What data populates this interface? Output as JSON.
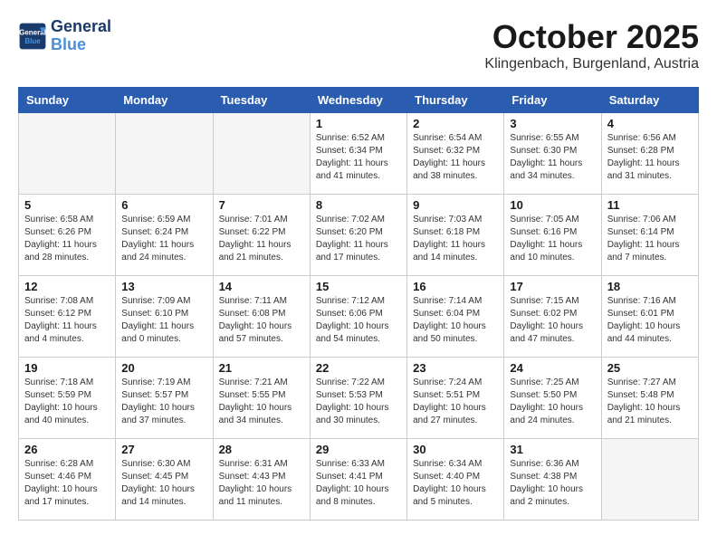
{
  "header": {
    "logo_line1": "General",
    "logo_line2": "Blue",
    "month": "October 2025",
    "location": "Klingenbach, Burgenland, Austria"
  },
  "days_of_week": [
    "Sunday",
    "Monday",
    "Tuesday",
    "Wednesday",
    "Thursday",
    "Friday",
    "Saturday"
  ],
  "weeks": [
    [
      {
        "day": "",
        "info": ""
      },
      {
        "day": "",
        "info": ""
      },
      {
        "day": "",
        "info": ""
      },
      {
        "day": "1",
        "info": "Sunrise: 6:52 AM\nSunset: 6:34 PM\nDaylight: 11 hours\nand 41 minutes."
      },
      {
        "day": "2",
        "info": "Sunrise: 6:54 AM\nSunset: 6:32 PM\nDaylight: 11 hours\nand 38 minutes."
      },
      {
        "day": "3",
        "info": "Sunrise: 6:55 AM\nSunset: 6:30 PM\nDaylight: 11 hours\nand 34 minutes."
      },
      {
        "day": "4",
        "info": "Sunrise: 6:56 AM\nSunset: 6:28 PM\nDaylight: 11 hours\nand 31 minutes."
      }
    ],
    [
      {
        "day": "5",
        "info": "Sunrise: 6:58 AM\nSunset: 6:26 PM\nDaylight: 11 hours\nand 28 minutes."
      },
      {
        "day": "6",
        "info": "Sunrise: 6:59 AM\nSunset: 6:24 PM\nDaylight: 11 hours\nand 24 minutes."
      },
      {
        "day": "7",
        "info": "Sunrise: 7:01 AM\nSunset: 6:22 PM\nDaylight: 11 hours\nand 21 minutes."
      },
      {
        "day": "8",
        "info": "Sunrise: 7:02 AM\nSunset: 6:20 PM\nDaylight: 11 hours\nand 17 minutes."
      },
      {
        "day": "9",
        "info": "Sunrise: 7:03 AM\nSunset: 6:18 PM\nDaylight: 11 hours\nand 14 minutes."
      },
      {
        "day": "10",
        "info": "Sunrise: 7:05 AM\nSunset: 6:16 PM\nDaylight: 11 hours\nand 10 minutes."
      },
      {
        "day": "11",
        "info": "Sunrise: 7:06 AM\nSunset: 6:14 PM\nDaylight: 11 hours\nand 7 minutes."
      }
    ],
    [
      {
        "day": "12",
        "info": "Sunrise: 7:08 AM\nSunset: 6:12 PM\nDaylight: 11 hours\nand 4 minutes."
      },
      {
        "day": "13",
        "info": "Sunrise: 7:09 AM\nSunset: 6:10 PM\nDaylight: 11 hours\nand 0 minutes."
      },
      {
        "day": "14",
        "info": "Sunrise: 7:11 AM\nSunset: 6:08 PM\nDaylight: 10 hours\nand 57 minutes."
      },
      {
        "day": "15",
        "info": "Sunrise: 7:12 AM\nSunset: 6:06 PM\nDaylight: 10 hours\nand 54 minutes."
      },
      {
        "day": "16",
        "info": "Sunrise: 7:14 AM\nSunset: 6:04 PM\nDaylight: 10 hours\nand 50 minutes."
      },
      {
        "day": "17",
        "info": "Sunrise: 7:15 AM\nSunset: 6:02 PM\nDaylight: 10 hours\nand 47 minutes."
      },
      {
        "day": "18",
        "info": "Sunrise: 7:16 AM\nSunset: 6:01 PM\nDaylight: 10 hours\nand 44 minutes."
      }
    ],
    [
      {
        "day": "19",
        "info": "Sunrise: 7:18 AM\nSunset: 5:59 PM\nDaylight: 10 hours\nand 40 minutes."
      },
      {
        "day": "20",
        "info": "Sunrise: 7:19 AM\nSunset: 5:57 PM\nDaylight: 10 hours\nand 37 minutes."
      },
      {
        "day": "21",
        "info": "Sunrise: 7:21 AM\nSunset: 5:55 PM\nDaylight: 10 hours\nand 34 minutes."
      },
      {
        "day": "22",
        "info": "Sunrise: 7:22 AM\nSunset: 5:53 PM\nDaylight: 10 hours\nand 30 minutes."
      },
      {
        "day": "23",
        "info": "Sunrise: 7:24 AM\nSunset: 5:51 PM\nDaylight: 10 hours\nand 27 minutes."
      },
      {
        "day": "24",
        "info": "Sunrise: 7:25 AM\nSunset: 5:50 PM\nDaylight: 10 hours\nand 24 minutes."
      },
      {
        "day": "25",
        "info": "Sunrise: 7:27 AM\nSunset: 5:48 PM\nDaylight: 10 hours\nand 21 minutes."
      }
    ],
    [
      {
        "day": "26",
        "info": "Sunrise: 6:28 AM\nSunset: 4:46 PM\nDaylight: 10 hours\nand 17 minutes."
      },
      {
        "day": "27",
        "info": "Sunrise: 6:30 AM\nSunset: 4:45 PM\nDaylight: 10 hours\nand 14 minutes."
      },
      {
        "day": "28",
        "info": "Sunrise: 6:31 AM\nSunset: 4:43 PM\nDaylight: 10 hours\nand 11 minutes."
      },
      {
        "day": "29",
        "info": "Sunrise: 6:33 AM\nSunset: 4:41 PM\nDaylight: 10 hours\nand 8 minutes."
      },
      {
        "day": "30",
        "info": "Sunrise: 6:34 AM\nSunset: 4:40 PM\nDaylight: 10 hours\nand 5 minutes."
      },
      {
        "day": "31",
        "info": "Sunrise: 6:36 AM\nSunset: 4:38 PM\nDaylight: 10 hours\nand 2 minutes."
      },
      {
        "day": "",
        "info": ""
      }
    ]
  ]
}
